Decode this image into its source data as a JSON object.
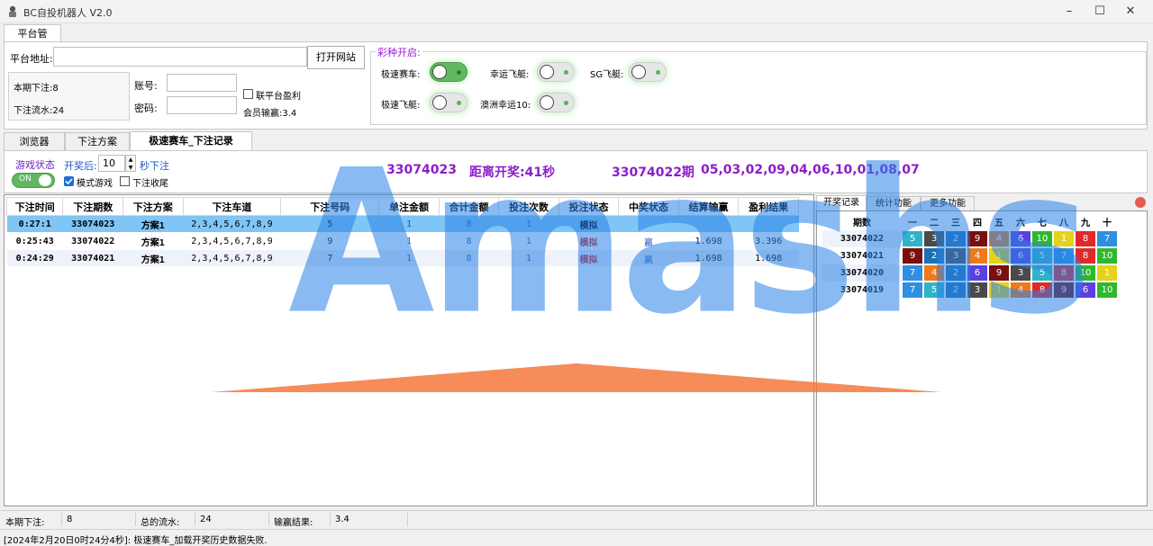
{
  "window": {
    "title": "BC自投机器人 V2.0"
  },
  "top_tabs": [
    {
      "label": "平台管理",
      "active": true
    }
  ],
  "platform": {
    "address_label": "平台地址:",
    "address_value": "",
    "open_site_button": "打开网站",
    "current_bet_label": "本期下注:8",
    "turnover_label": "下注流水:24",
    "account_label": "账号:",
    "account_value": "",
    "password_label": "密码:",
    "password_value": "",
    "platform_profit_checkbox": "联平台盈利",
    "member_winloss": "会员输赢:3.4"
  },
  "lottery_group": {
    "legend": "彩种开启:",
    "switches": [
      {
        "label": "极速赛车:",
        "on": true
      },
      {
        "label": "幸运飞艇:",
        "on": false
      },
      {
        "label": "SG飞艇:",
        "on": false
      },
      {
        "label": "极速飞艇:",
        "on": false
      },
      {
        "label": "澳洲幸运10:",
        "on": false
      }
    ]
  },
  "main_tabs": [
    {
      "label": "浏览器",
      "active": false
    },
    {
      "label": "下注方案",
      "active": false
    },
    {
      "label": "极速赛车_下注记录",
      "active": true
    }
  ],
  "controls": {
    "game_status_label": "游戏状态",
    "toggle_label": "ON",
    "after_draw_label": "开奖后:",
    "seconds_value": "10",
    "seconds_bet_label": "秒下注",
    "mode_game_checkbox": "模式游戏",
    "mode_game_checked": true,
    "close_tail_checkbox": "下注收尾",
    "close_tail_checked": false
  },
  "banner": {
    "current_issue": "33074023",
    "countdown": "距离开奖:41秒",
    "last_issue": "33074022期",
    "last_numbers": "05,03,02,09,04,06,10,01,08,07"
  },
  "bet_table": {
    "columns": [
      "下注时间",
      "下注期数",
      "下注方案",
      "下注车道",
      "下注号码",
      "单注金额",
      "合计金额",
      "投注次数",
      "投注状态",
      "中奖状态",
      "结算输赢",
      "盈利结果"
    ],
    "rows": [
      [
        "0:27:1",
        "33074023",
        "方案1",
        "2,3,4,5,6,7,8,9",
        "5",
        "1",
        "8",
        "1",
        "模拟",
        "",
        "",
        ""
      ],
      [
        "0:25:43",
        "33074022",
        "方案1",
        "2,3,4,5,6,7,8,9",
        "9",
        "1",
        "8",
        "1",
        "模拟",
        "赢",
        "1.698",
        "3.396"
      ],
      [
        "0:24:29",
        "33074021",
        "方案1",
        "2,3,4,5,6,7,8,9",
        "7",
        "1",
        "8",
        "1",
        "模拟",
        "赢",
        "1.698",
        "1.698"
      ]
    ]
  },
  "right_tabs": [
    {
      "label": "开奖记录",
      "active": true
    },
    {
      "label": "统计功能",
      "active": false
    },
    {
      "label": "更多功能",
      "active": false
    }
  ],
  "draw_table": {
    "issue_header": "期数",
    "position_headers": [
      "一",
      "二",
      "三",
      "四",
      "五",
      "六",
      "七",
      "八",
      "九",
      "十"
    ],
    "rows": [
      {
        "issue": "33074022",
        "numbers": [
          5,
          3,
          2,
          9,
          4,
          6,
          10,
          1,
          8,
          7
        ]
      },
      {
        "issue": "33074021",
        "numbers": [
          9,
          2,
          3,
          4,
          1,
          6,
          5,
          7,
          8,
          10
        ]
      },
      {
        "issue": "33074020",
        "numbers": [
          7,
          4,
          2,
          6,
          9,
          3,
          5,
          8,
          10,
          1
        ]
      },
      {
        "issue": "33074019",
        "numbers": [
          7,
          5,
          2,
          3,
          1,
          4,
          8,
          9,
          6,
          10
        ]
      }
    ],
    "ball_colors": {
      "1": "#e4d21b",
      "2": "#1b6fb5",
      "3": "#4a4a4a",
      "4": "#ee7a1b",
      "5": "#2fb3c7",
      "6": "#5c3fe0",
      "7": "#2f8fe0",
      "8": "#e02929",
      "9": "#7a0f0f",
      "10": "#2fb82f"
    }
  },
  "watermark": "Amashs",
  "statusbar": {
    "current_bet_label": "本期下注:",
    "current_bet_value": "8",
    "total_turnover_label": "总的流水:",
    "total_turnover_value": "24",
    "winloss_label": "输赢结果:",
    "winloss_value": "3.4"
  },
  "log": "[2024年2月20日0时24分4秒]: 极速赛车_加载开奖历史数据失败."
}
